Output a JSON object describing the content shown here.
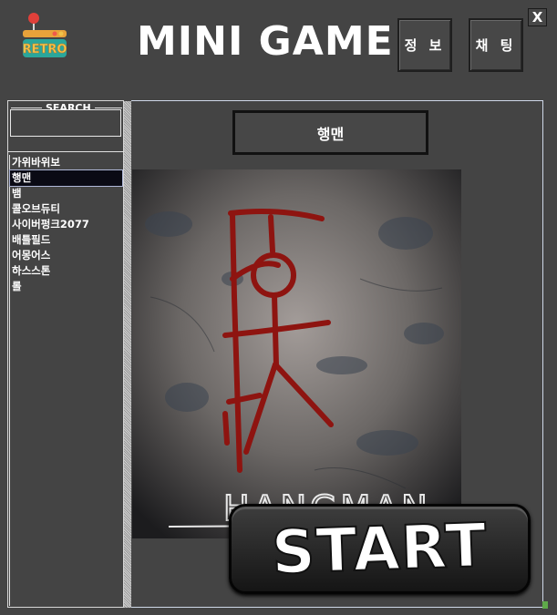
{
  "header": {
    "logo_text": "RETRO",
    "title": "MINI GAME",
    "info_label": "정 보",
    "chat_label": "채 팅",
    "close_label": "X"
  },
  "sidebar": {
    "search_legend": "SEARCH",
    "search_value": "",
    "games": [
      "가위바위보",
      "행맨",
      "뱀",
      "콜오브듀티",
      "사이버펑크2077",
      "배틀필드",
      "어몽어스",
      "하스스톤",
      "롤"
    ],
    "selected_index": 1
  },
  "main": {
    "game_title": "행맨",
    "art_text": "HANGMAN",
    "start_label": "START"
  },
  "colors": {
    "background": "#444444",
    "art_blood": "#8e1410",
    "logo_orange": "#e8a23a",
    "logo_teal": "#2aa79b"
  }
}
